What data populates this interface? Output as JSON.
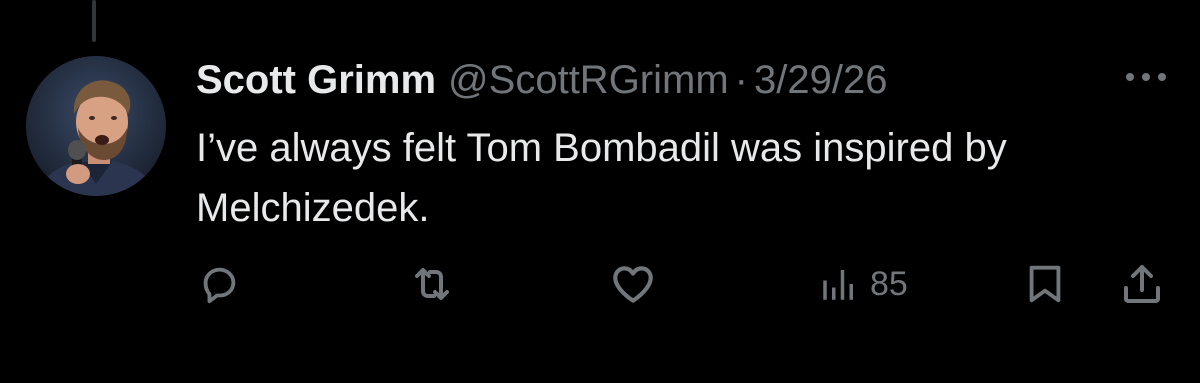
{
  "tweet": {
    "author": {
      "display_name": "Scott Grimm",
      "handle": "@ScottRGrimm",
      "avatar": "avatar"
    },
    "separator": "·",
    "date": "3/29/26",
    "text": "I’ve always felt Tom Bombadil was inspired by Melchizedek."
  },
  "actions": {
    "reply": {
      "icon": "reply-icon"
    },
    "retweet": {
      "icon": "retweet-icon"
    },
    "like": {
      "icon": "heart-icon"
    },
    "views": {
      "icon": "views-chart-icon",
      "count": "85"
    },
    "bookmark": {
      "icon": "bookmark-icon"
    },
    "share": {
      "icon": "share-icon"
    },
    "more": {
      "icon": "more-dots-icon"
    }
  },
  "colors": {
    "background": "#000000",
    "primary_text": "#e7e9ea",
    "secondary_text": "#71767b",
    "thread_line": "#333639"
  }
}
